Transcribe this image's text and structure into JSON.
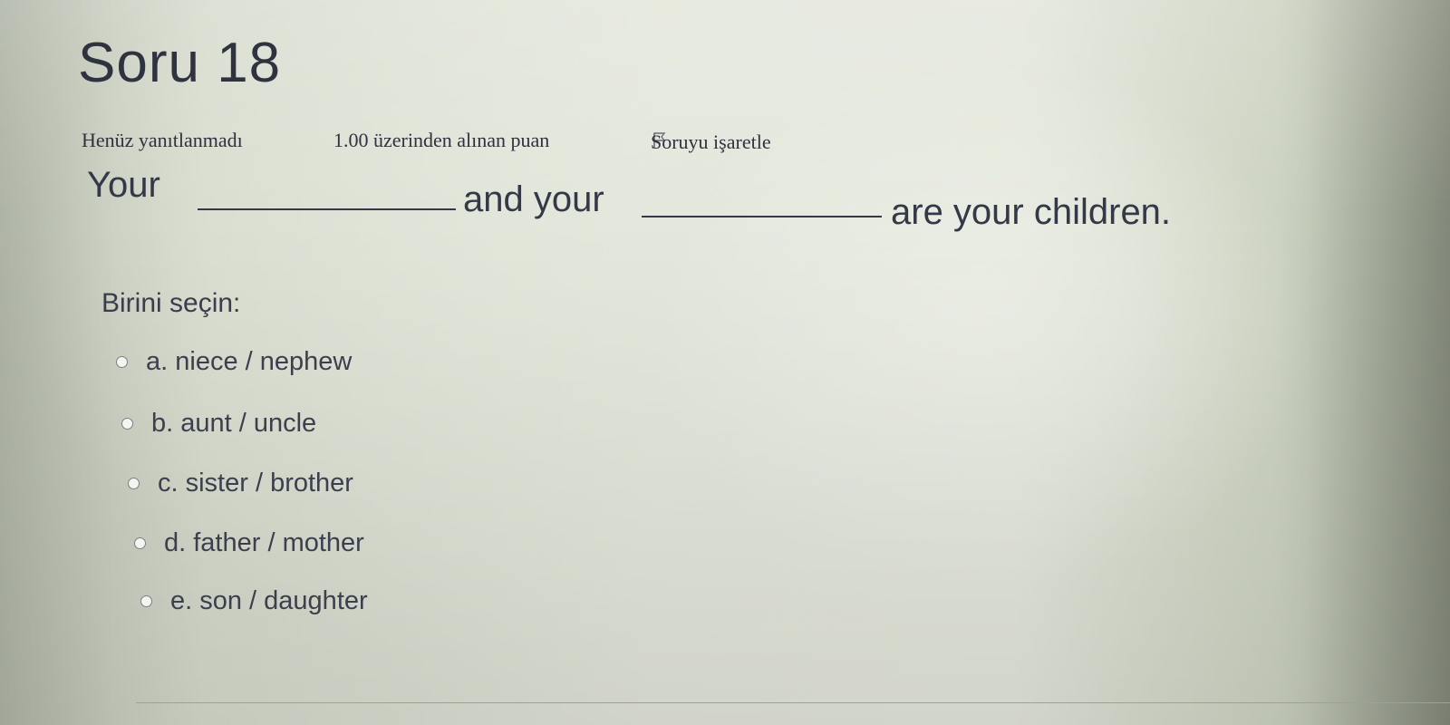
{
  "question": {
    "title": "Soru 18",
    "status": "Henüz yanıtlanmadı",
    "points": "1.00 üzerinden alınan puan",
    "flag_label": "Soruyu işaretle",
    "flag_icon": "flag-icon",
    "text_part1": "Your",
    "text_part2": "and your",
    "text_part3": "are your children.",
    "prompt": "Birini seçin:",
    "options": [
      {
        "label": "a. niece / nephew",
        "selected": false
      },
      {
        "label": "b. aunt / uncle",
        "selected": false
      },
      {
        "label": "c. sister / brother",
        "selected": false
      },
      {
        "label": "d. father / mother",
        "selected": false
      },
      {
        "label": "e. son / daughter",
        "selected": false
      }
    ]
  },
  "colors": {
    "text": "#343948",
    "background": "#e3e6da",
    "radio_border": "#7a7f86"
  }
}
